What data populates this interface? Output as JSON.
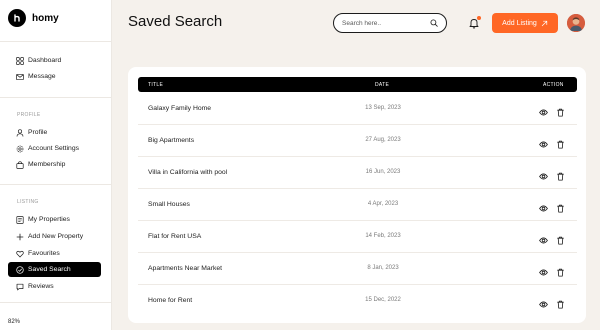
{
  "brand": {
    "name": "homy"
  },
  "sidebar": {
    "main_items": [
      {
        "label": "Dashboard",
        "icon": "grid-icon"
      },
      {
        "label": "Message",
        "icon": "mail-icon"
      }
    ],
    "profile_section": "PROFILE",
    "profile_items": [
      {
        "label": "Profile",
        "icon": "user-icon"
      },
      {
        "label": "Account Settings",
        "icon": "gear-icon"
      },
      {
        "label": "Membership",
        "icon": "bag-icon"
      }
    ],
    "listing_section": "LISTING",
    "listing_items": [
      {
        "label": "My Properties",
        "icon": "list-icon"
      },
      {
        "label": "Add New Property",
        "icon": "plus-icon"
      },
      {
        "label": "Favourites",
        "icon": "heart-icon"
      },
      {
        "label": "Saved Search",
        "icon": "check-circle-icon",
        "active": true
      },
      {
        "label": "Reviews",
        "icon": "chat-icon"
      }
    ]
  },
  "zoom_level": "82%",
  "header": {
    "title": "Saved Search",
    "search_placeholder": "Search here..",
    "add_button_label": "Add Listing",
    "accent_color": "#ff6725"
  },
  "table": {
    "columns": {
      "title": "TITLE",
      "date": "DATE",
      "action": "ACTION"
    },
    "rows": [
      {
        "title": "Galaxy Family Home",
        "date": "13 Sep, 2023"
      },
      {
        "title": "Big Apartments",
        "date": "27 Aug, 2023"
      },
      {
        "title": "Villa in California with pool",
        "date": "16 Jun, 2023"
      },
      {
        "title": "Small Houses",
        "date": "4 Apr, 2023"
      },
      {
        "title": "Flat for Rent USA",
        "date": "14 Feb, 2023"
      },
      {
        "title": "Apartments Near Market",
        "date": "8 Jan, 2023"
      },
      {
        "title": "Home for Rent",
        "date": "15 Dec, 2022"
      }
    ]
  }
}
